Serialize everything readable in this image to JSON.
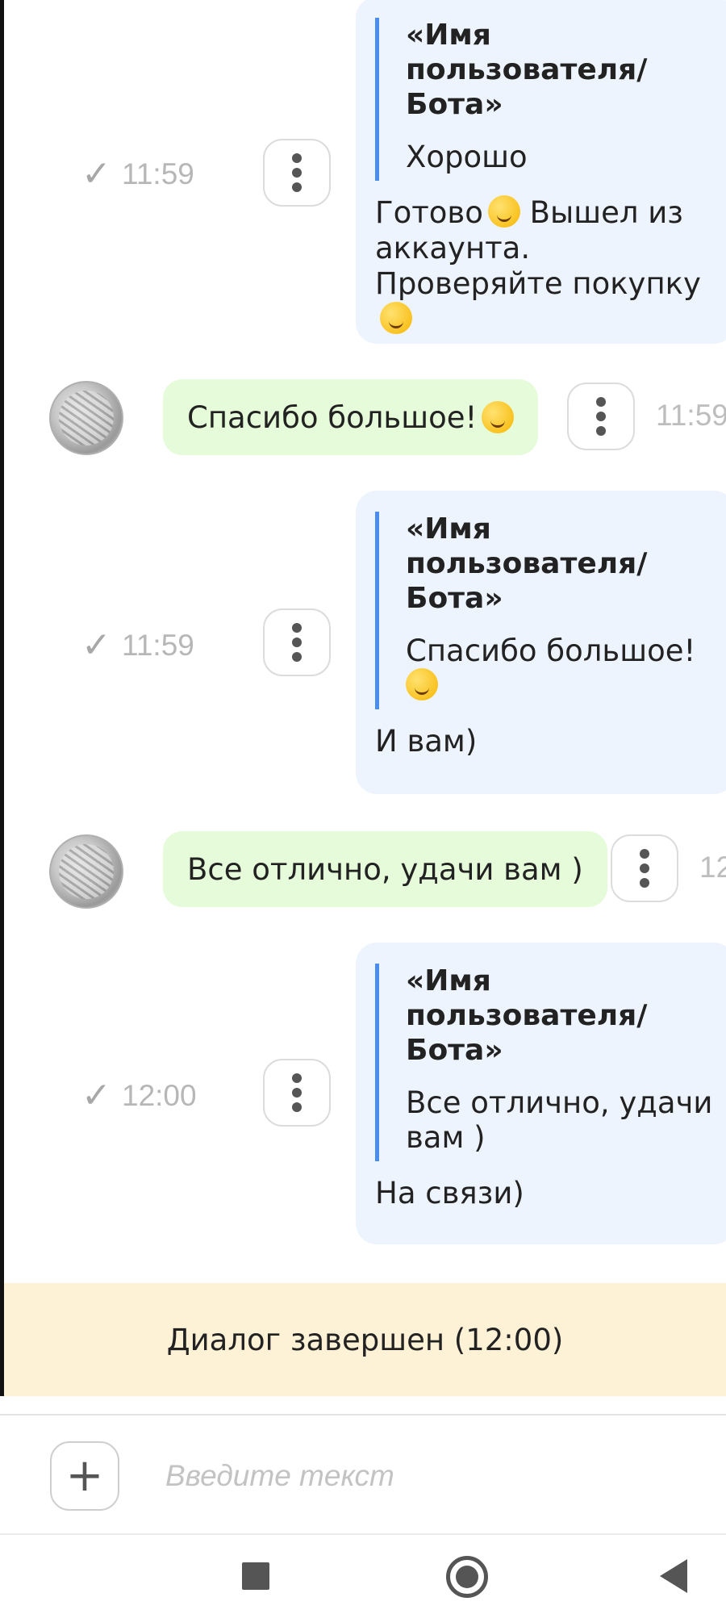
{
  "messages": [
    {
      "quote_author": "«Имя пользователя/ Бота»",
      "quote_text": "Хорошо",
      "text": "Готово",
      "text_emoji": "party-face-emoji",
      "text_after": "Вышел из аккаунта. Проверяйте покупку",
      "text_emoji_2": "yum-face-emoji",
      "time": "11:59",
      "status": "sent"
    },
    {
      "incoming_text": "Спасибо большое!",
      "incoming_emoji": "hugging-face-emoji",
      "time": "11:59"
    },
    {
      "quote_author": "«Имя пользователя/ Бота»",
      "quote_text": "Спасибо большое!",
      "quote_emoji": "hugging-face-emoji",
      "text": "И вам)",
      "time": "11:59",
      "status": "sent"
    },
    {
      "incoming_text": "Все отлично, удачи вам )",
      "time": "12"
    },
    {
      "quote_author": "«Имя пользователя/ Бота»",
      "quote_text": "Все отлично, удачи вам )",
      "text": "На связи)",
      "time": "12:00",
      "status": "sent"
    }
  ],
  "banner": {
    "text": "Диалог завершен (12:00)"
  },
  "composer": {
    "placeholder": "Введите текст",
    "add_icon": "plus-icon"
  },
  "nav": {
    "icons": [
      "recent-apps-icon",
      "home-icon",
      "back-icon"
    ]
  },
  "colors": {
    "outgoing_bubble": "#eef4fe",
    "incoming_bubble": "#e5fbd9",
    "quote_bar": "#4a8df0",
    "banner": "#fdf1d6"
  }
}
